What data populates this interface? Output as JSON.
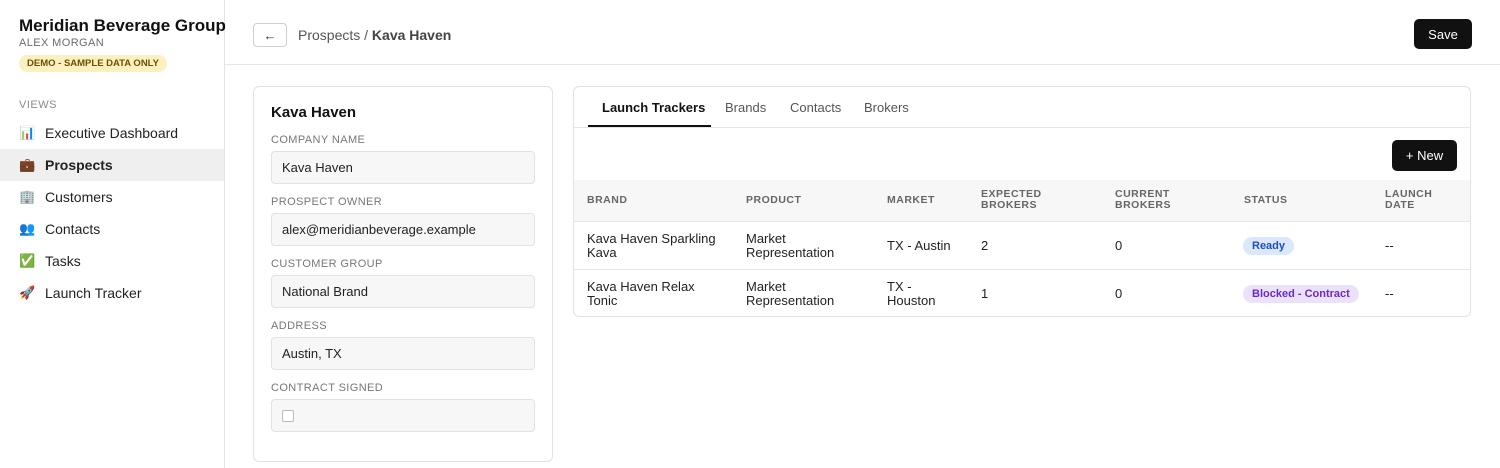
{
  "sidebar": {
    "org_name": "Meridian Beverage Group",
    "user_name": "ALEX MORGAN",
    "demo_badge": "DEMO - SAMPLE DATA ONLY",
    "views_label": "VIEWS",
    "items": [
      {
        "icon": "📊",
        "icon_name": "bar-chart-icon",
        "label": "Executive Dashboard"
      },
      {
        "icon": "💼",
        "icon_name": "briefcase-icon",
        "label": "Prospects"
      },
      {
        "icon": "🏢",
        "icon_name": "office-building-icon",
        "label": "Customers"
      },
      {
        "icon": "👥",
        "icon_name": "people-icon",
        "label": "Contacts"
      },
      {
        "icon": "✅",
        "icon_name": "check-mark-icon",
        "label": "Tasks"
      },
      {
        "icon": "🚀",
        "icon_name": "rocket-icon",
        "label": "Launch Tracker"
      }
    ],
    "active_item": "Prospects"
  },
  "header": {
    "back_icon": "←",
    "breadcrumb_parent": "Prospects",
    "breadcrumb_separator": " / ",
    "breadcrumb_current": "Kava Haven",
    "save_label": "Save"
  },
  "detail": {
    "title": "Kava Haven",
    "fields": [
      {
        "label": "COMPANY NAME",
        "value": "Kava Haven"
      },
      {
        "label": "PROSPECT OWNER",
        "value": "alex@meridianbeverage.example"
      },
      {
        "label": "CUSTOMER GROUP",
        "value": "National Brand"
      },
      {
        "label": "ADDRESS",
        "value": "Austin, TX"
      }
    ],
    "contract_label": "CONTRACT SIGNED",
    "contract_signed": false
  },
  "trackers": {
    "tabs": [
      "Launch Trackers",
      "Brands",
      "Contacts",
      "Brokers"
    ],
    "active_tab": "Launch Trackers",
    "new_label": "+ New",
    "columns": [
      [
        "BRAND"
      ],
      [
        "PRODUCT"
      ],
      [
        "MARKET"
      ],
      [
        "EXPECTED",
        "BROKERS"
      ],
      [
        "CURRENT",
        "BROKERS"
      ],
      [
        "STATUS"
      ],
      [
        "LAUNCH",
        "DATE"
      ]
    ],
    "rows": [
      {
        "brand": [
          "Kava Haven Sparkling",
          "Kava"
        ],
        "product": [
          "Market",
          "Representation"
        ],
        "market": [
          "TX - Austin"
        ],
        "expected_brokers": "2",
        "current_brokers": "0",
        "status": "Ready",
        "launch_date": "--"
      },
      {
        "brand": [
          "Kava Haven Relax",
          "Tonic"
        ],
        "product": [
          "Market",
          "Representation"
        ],
        "market": [
          "TX -",
          "Houston"
        ],
        "expected_brokers": "1",
        "current_brokers": "0",
        "status": "Blocked - Contract",
        "launch_date": "--"
      }
    ]
  },
  "colors": {
    "primary_button": "#111111",
    "demo_badge_bg": "#fdf0c0",
    "status_ready_bg": "#dbe8fb",
    "status_ready_text": "#1f4fb8",
    "status_blocked_bg": "#ece1fb",
    "status_blocked_text": "#6a2cc0"
  }
}
